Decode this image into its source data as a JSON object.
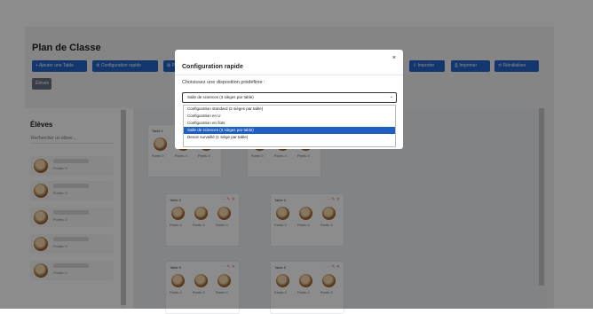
{
  "app": {
    "title": "Plan de Classe",
    "toolbar": [
      {
        "label": "+ Ajouter une Table"
      },
      {
        "label": "⚙ Configuration rapide"
      },
      {
        "label": "⊞ P"
      },
      {
        "label": "⇩ Importer"
      },
      {
        "label": "⎙ Imprimer"
      },
      {
        "label": "⟲ Réinitialiser"
      },
      {
        "label": "Élèves"
      }
    ]
  },
  "sidebar": {
    "title": "Élèves",
    "search_placeholder": "Rechercher un élève...",
    "students": [
      {
        "points": "Points: 0"
      },
      {
        "points": "Points: 0"
      },
      {
        "points": "Points: 0"
      },
      {
        "points": "Points: 0"
      },
      {
        "points": "Points: 0"
      }
    ]
  },
  "tables": [
    {
      "name": "Table 1",
      "seats": [
        "Points: 0",
        "Points: 0",
        "Points: 0"
      ]
    },
    {
      "name": "Table 2",
      "seats": [
        "Points: 0",
        "Points: 0",
        "Points: 0"
      ]
    },
    {
      "name": "Table 3",
      "seats": [
        "Points: 0",
        "Points: 0",
        "Points: 0"
      ]
    },
    {
      "name": "Table 4",
      "seats": [
        "Points: 0",
        "Points: 0",
        "Points: 0"
      ]
    },
    {
      "name": "Table 5",
      "seats": [
        "Points: 0",
        "Points: 0",
        "Points: 0"
      ]
    },
    {
      "name": "Table 6",
      "seats": [
        "Points: 0",
        "Points: 0",
        "Points: 0"
      ]
    }
  ],
  "modal": {
    "close_icon": "×",
    "title": "Configuration rapide",
    "prompt": "Choisissez une disposition prédéfinie :",
    "selected_value": "Salle de sciences (3 sièges par table)",
    "chevron_icon": "⌄",
    "options": [
      {
        "label": "Configuration standard (2 sièges par table)",
        "selected": false
      },
      {
        "label": "Configuration en U",
        "selected": false
      },
      {
        "label": "Configuration en îlots",
        "selected": false
      },
      {
        "label": "Salle de sciences (3 sièges par table)",
        "selected": true
      },
      {
        "label": "Devoir surveillé (1 siège par table)",
        "selected": false
      }
    ]
  },
  "table_actions_icons": "⋯ ✎ ✕"
}
